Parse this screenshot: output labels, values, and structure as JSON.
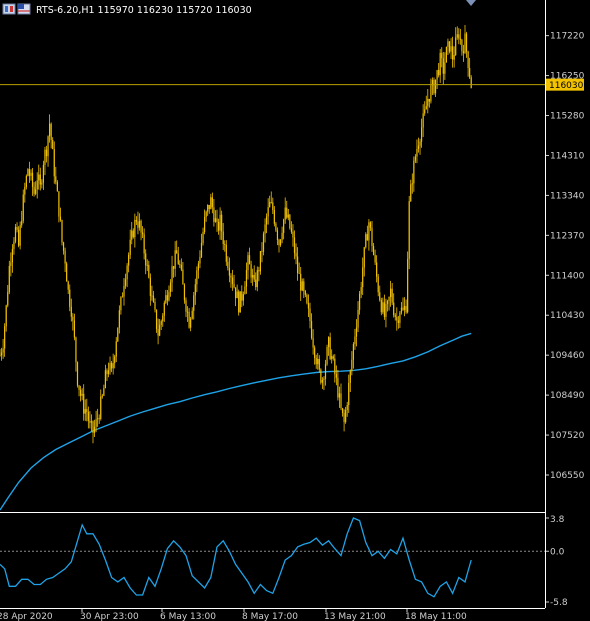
{
  "header": {
    "symbol_line": "RTS-6.20,H1  115970 116230 115720 116030"
  },
  "colors": {
    "background": "#000000",
    "candle": "#f2c200",
    "ma_line": "#1fa3e8",
    "indicator_line": "#1fa3e8",
    "hline": "#b8a000",
    "price_tag_bg": "#f2c200",
    "axis_text": "#cfcfcf",
    "separator": "#ffffff"
  },
  "icons": [
    "window-icon",
    "flag-icon",
    "scroll-marker-icon"
  ],
  "chart_data": [
    {
      "type": "candlestick",
      "symbol": "RTS-6.20",
      "timeframe": "H1",
      "ohlc_current": {
        "open": 115970,
        "high": 116230,
        "low": 115720,
        "close": 116030
      },
      "ylim": [
        105700,
        117600
      ],
      "yticks": [
        117220,
        116250,
        115280,
        114310,
        113340,
        112370,
        111400,
        110430,
        109460,
        108490,
        107520,
        106550
      ],
      "yticks_labels": [
        "117220",
        "116250",
        "115280",
        "114310",
        "113340",
        "112370",
        "111400",
        "110430",
        "109460",
        "108490",
        "107520",
        "106550"
      ],
      "current_price_label": "116030",
      "hline_value": 116030,
      "x_ticks": [
        "28 Apr 2020",
        "30 Apr 23:00",
        "6 May 13:00",
        "8 May 17:00",
        "13 May 21:00",
        "18 May 11:00"
      ],
      "close_path": [
        [
          0,
          109460
        ],
        [
          2,
          109800
        ],
        [
          4,
          110600
        ],
        [
          6,
          111600
        ],
        [
          8,
          112200
        ],
        [
          10,
          112500
        ],
        [
          12,
          112100
        ],
        [
          14,
          112900
        ],
        [
          16,
          113500
        ],
        [
          18,
          114000
        ],
        [
          20,
          113700
        ],
        [
          22,
          113400
        ],
        [
          24,
          113800
        ],
        [
          26,
          113500
        ],
        [
          28,
          114200
        ],
        [
          30,
          114500
        ],
        [
          32,
          115100
        ],
        [
          34,
          114300
        ],
        [
          36,
          113600
        ],
        [
          38,
          113000
        ],
        [
          40,
          112200
        ],
        [
          42,
          111800
        ],
        [
          44,
          111000
        ],
        [
          46,
          110600
        ],
        [
          48,
          109800
        ],
        [
          50,
          108900
        ],
        [
          52,
          108500
        ],
        [
          54,
          108200
        ],
        [
          56,
          108100
        ],
        [
          58,
          107700
        ],
        [
          60,
          107600
        ],
        [
          62,
          107800
        ],
        [
          64,
          108100
        ],
        [
          66,
          108400
        ],
        [
          68,
          108900
        ],
        [
          70,
          109200
        ],
        [
          72,
          109000
        ],
        [
          74,
          109600
        ],
        [
          76,
          110200
        ],
        [
          78,
          110700
        ],
        [
          80,
          111300
        ],
        [
          82,
          111700
        ],
        [
          84,
          112100
        ],
        [
          86,
          112500
        ],
        [
          88,
          112800
        ],
        [
          90,
          112600
        ],
        [
          92,
          112200
        ],
        [
          94,
          111800
        ],
        [
          96,
          111300
        ],
        [
          98,
          110800
        ],
        [
          100,
          110400
        ],
        [
          102,
          110000
        ],
        [
          104,
          110300
        ],
        [
          106,
          110700
        ],
        [
          108,
          111000
        ],
        [
          110,
          111400
        ],
        [
          112,
          111700
        ],
        [
          114,
          111900
        ],
        [
          116,
          111600
        ],
        [
          118,
          111100
        ],
        [
          120,
          110700
        ],
        [
          122,
          110300
        ],
        [
          124,
          110700
        ],
        [
          126,
          111200
        ],
        [
          128,
          111700
        ],
        [
          130,
          112200
        ],
        [
          132,
          112700
        ],
        [
          134,
          113000
        ],
        [
          136,
          113200
        ],
        [
          138,
          112900
        ],
        [
          140,
          112500
        ],
        [
          142,
          112700
        ],
        [
          144,
          112300
        ],
        [
          146,
          111900
        ],
        [
          148,
          111600
        ],
        [
          150,
          111300
        ],
        [
          152,
          111000
        ],
        [
          154,
          110700
        ],
        [
          156,
          110900
        ],
        [
          158,
          111300
        ],
        [
          160,
          111700
        ],
        [
          162,
          111500
        ],
        [
          164,
          111100
        ],
        [
          166,
          111400
        ],
        [
          168,
          111800
        ],
        [
          170,
          112300
        ],
        [
          172,
          112800
        ],
        [
          174,
          113100
        ],
        [
          176,
          113000
        ],
        [
          178,
          112600
        ],
        [
          180,
          112200
        ],
        [
          182,
          112600
        ],
        [
          184,
          112900
        ],
        [
          186,
          112700
        ],
        [
          188,
          112400
        ],
        [
          190,
          112000
        ],
        [
          192,
          111500
        ],
        [
          194,
          111200
        ],
        [
          196,
          110900
        ],
        [
          198,
          110600
        ],
        [
          200,
          110300
        ],
        [
          202,
          109800
        ],
        [
          204,
          109400
        ],
        [
          206,
          109000
        ],
        [
          208,
          108900
        ],
        [
          210,
          109300
        ],
        [
          212,
          109700
        ],
        [
          214,
          109400
        ],
        [
          216,
          109000
        ],
        [
          218,
          108600
        ],
        [
          220,
          108100
        ],
        [
          222,
          107800
        ],
        [
          224,
          108400
        ],
        [
          226,
          109000
        ],
        [
          228,
          109700
        ],
        [
          230,
          110300
        ],
        [
          232,
          110900
        ],
        [
          234,
          111600
        ],
        [
          236,
          112200
        ],
        [
          238,
          112700
        ],
        [
          240,
          112200
        ],
        [
          242,
          111600
        ],
        [
          244,
          111100
        ],
        [
          246,
          110700
        ],
        [
          248,
          110400
        ],
        [
          250,
          110600
        ],
        [
          252,
          111000
        ],
        [
          254,
          110600
        ],
        [
          256,
          110300
        ],
        [
          258,
          110600
        ],
        [
          260,
          110500
        ],
        [
          262,
          110700
        ],
        [
          264,
          113100
        ],
        [
          266,
          113800
        ],
        [
          268,
          114300
        ],
        [
          270,
          114700
        ],
        [
          272,
          115000
        ],
        [
          274,
          115300
        ],
        [
          276,
          115700
        ],
        [
          278,
          115900
        ],
        [
          280,
          116000
        ],
        [
          282,
          116300
        ],
        [
          284,
          116600
        ],
        [
          286,
          116400
        ],
        [
          288,
          116800
        ],
        [
          290,
          117000
        ],
        [
          292,
          116700
        ],
        [
          294,
          117000
        ],
        [
          296,
          117300
        ],
        [
          298,
          116900
        ],
        [
          300,
          117100
        ],
        [
          302,
          116600
        ],
        [
          304,
          116030
        ]
      ],
      "ma_path": [
        [
          0,
          105700
        ],
        [
          5,
          105990
        ],
        [
          12,
          106370
        ],
        [
          20,
          106720
        ],
        [
          28,
          106970
        ],
        [
          36,
          107170
        ],
        [
          44,
          107320
        ],
        [
          52,
          107470
        ],
        [
          60,
          107620
        ],
        [
          68,
          107740
        ],
        [
          76,
          107860
        ],
        [
          84,
          107980
        ],
        [
          92,
          108080
        ],
        [
          100,
          108170
        ],
        [
          108,
          108260
        ],
        [
          116,
          108330
        ],
        [
          124,
          108420
        ],
        [
          132,
          108500
        ],
        [
          140,
          108570
        ],
        [
          148,
          108650
        ],
        [
          156,
          108720
        ],
        [
          164,
          108790
        ],
        [
          172,
          108850
        ],
        [
          180,
          108910
        ],
        [
          188,
          108960
        ],
        [
          196,
          109000
        ],
        [
          204,
          109040
        ],
        [
          212,
          109060
        ],
        [
          220,
          109070
        ],
        [
          228,
          109090
        ],
        [
          236,
          109130
        ],
        [
          244,
          109190
        ],
        [
          252,
          109260
        ],
        [
          260,
          109320
        ],
        [
          268,
          109420
        ],
        [
          276,
          109540
        ],
        [
          284,
          109690
        ],
        [
          292,
          109820
        ],
        [
          298,
          109920
        ],
        [
          304,
          109990
        ]
      ]
    },
    {
      "type": "line",
      "panel": "indicator",
      "ylim": [
        -5.8,
        3.8
      ],
      "yticks_labels": [
        "3.8",
        "0.0",
        "-5.8"
      ],
      "x_ticks": [
        "28 Apr 2020",
        "30 Apr 23:00",
        "6 May 13:00",
        "8 May 17:00",
        "13 May 21:00",
        "18 May 11:00"
      ],
      "values": [
        [
          0,
          -1.5
        ],
        [
          3,
          -2.0
        ],
        [
          6,
          -4.0
        ],
        [
          10,
          -4.0
        ],
        [
          14,
          -3.2
        ],
        [
          18,
          -3.2
        ],
        [
          22,
          -3.8
        ],
        [
          26,
          -3.8
        ],
        [
          30,
          -3.2
        ],
        [
          34,
          -3.0
        ],
        [
          38,
          -2.5
        ],
        [
          42,
          -2.0
        ],
        [
          46,
          -1.2
        ],
        [
          50,
          1.2
        ],
        [
          53,
          3.0
        ],
        [
          56,
          2.0
        ],
        [
          60,
          2.0
        ],
        [
          64,
          0.8
        ],
        [
          68,
          -1.0
        ],
        [
          72,
          -3.0
        ],
        [
          76,
          -3.5
        ],
        [
          80,
          -3.0
        ],
        [
          84,
          -4.2
        ],
        [
          88,
          -5.0
        ],
        [
          92,
          -5.0
        ],
        [
          96,
          -3.0
        ],
        [
          100,
          -4.0
        ],
        [
          104,
          -2.0
        ],
        [
          108,
          0.3
        ],
        [
          112,
          1.2
        ],
        [
          116,
          0.5
        ],
        [
          120,
          -0.5
        ],
        [
          124,
          -2.8
        ],
        [
          128,
          -3.5
        ],
        [
          132,
          -4.2
        ],
        [
          136,
          -3.0
        ],
        [
          140,
          0.5
        ],
        [
          144,
          1.2
        ],
        [
          148,
          0.0
        ],
        [
          152,
          -1.5
        ],
        [
          156,
          -2.5
        ],
        [
          160,
          -3.5
        ],
        [
          164,
          -4.8
        ],
        [
          168,
          -3.8
        ],
        [
          172,
          -4.5
        ],
        [
          176,
          -4.8
        ],
        [
          180,
          -3.0
        ],
        [
          184,
          -1.0
        ],
        [
          188,
          -0.5
        ],
        [
          192,
          0.5
        ],
        [
          196,
          0.8
        ],
        [
          200,
          1.0
        ],
        [
          204,
          1.5
        ],
        [
          208,
          0.7
        ],
        [
          212,
          1.2
        ],
        [
          216,
          0.3
        ],
        [
          220,
          -0.5
        ],
        [
          224,
          2.0
        ],
        [
          228,
          3.8
        ],
        [
          232,
          3.5
        ],
        [
          236,
          1.0
        ],
        [
          240,
          -0.5
        ],
        [
          244,
          0.0
        ],
        [
          248,
          -0.8
        ],
        [
          252,
          0.2
        ],
        [
          256,
          -0.3
        ],
        [
          260,
          1.5
        ],
        [
          264,
          -1.0
        ],
        [
          268,
          -3.2
        ],
        [
          272,
          -3.5
        ],
        [
          276,
          -4.8
        ],
        [
          280,
          -5.2
        ],
        [
          284,
          -4.0
        ],
        [
          288,
          -3.5
        ],
        [
          292,
          -4.8
        ],
        [
          296,
          -3.0
        ],
        [
          300,
          -3.5
        ],
        [
          304,
          -1.0
        ]
      ]
    }
  ]
}
